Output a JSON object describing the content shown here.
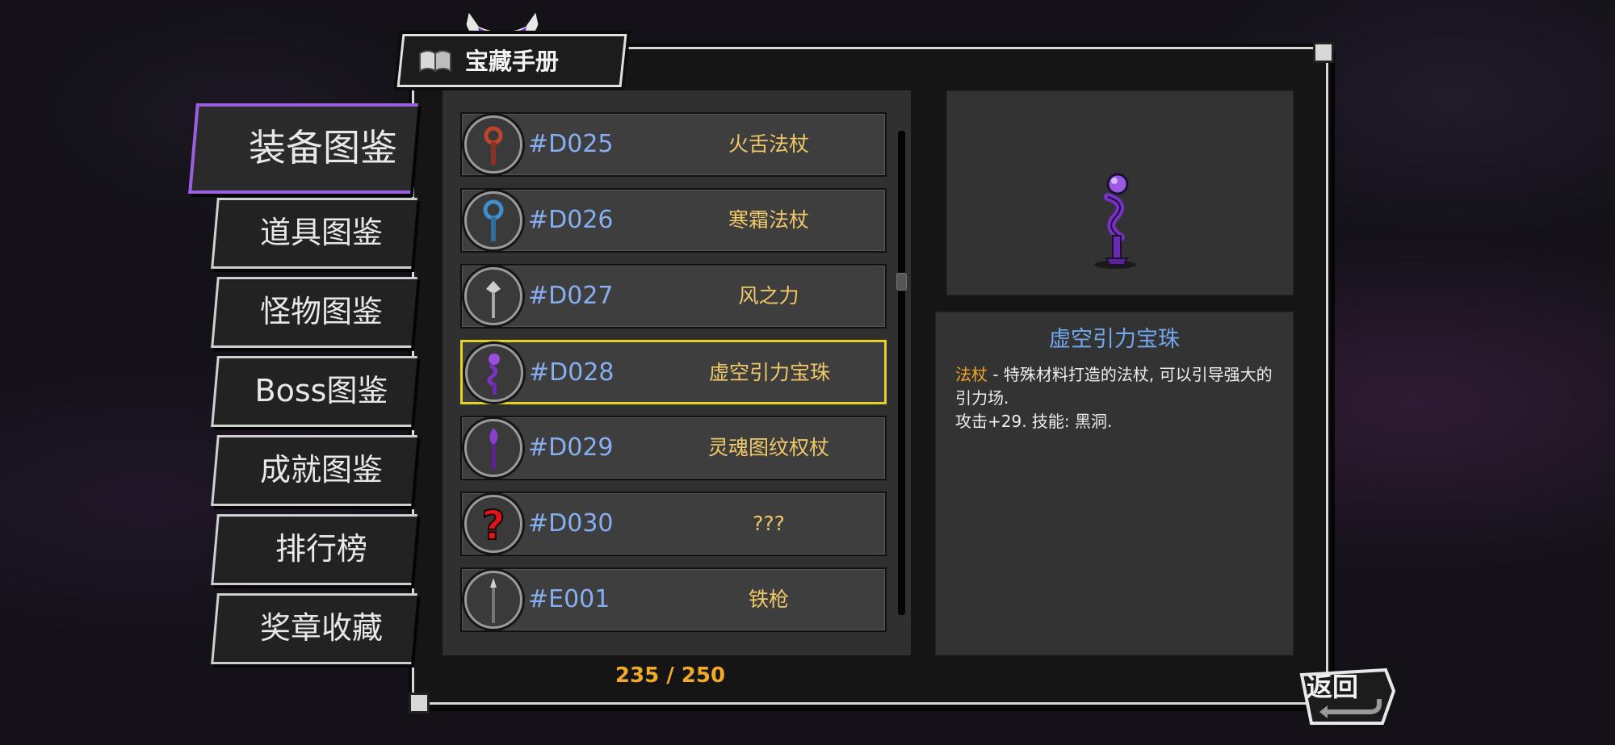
{
  "window": {
    "title": "宝藏手册"
  },
  "categories": [
    {
      "label": "装备图鉴",
      "active": true
    },
    {
      "label": "道具图鉴"
    },
    {
      "label": "怪物图鉴"
    },
    {
      "label": "Boss图鉴"
    },
    {
      "label": "成就图鉴"
    },
    {
      "label": "排行榜"
    },
    {
      "label": "奖章收藏"
    }
  ],
  "list": {
    "items": [
      {
        "code": "#D025",
        "name": "火舌法杖",
        "icon": "fire-staff-icon"
      },
      {
        "code": "#D026",
        "name": "寒霜法杖",
        "icon": "frost-staff-icon"
      },
      {
        "code": "#D027",
        "name": "风之力",
        "icon": "wind-staff-icon"
      },
      {
        "code": "#D028",
        "name": "虚空引力宝珠",
        "icon": "void-orb-staff-icon",
        "selected": true
      },
      {
        "code": "#D029",
        "name": "灵魂图纹权杖",
        "icon": "soul-scepter-icon"
      },
      {
        "code": "#D030",
        "name": "???",
        "icon": "question-mark-icon"
      },
      {
        "code": "#E001",
        "name": "铁枪",
        "icon": "iron-spear-icon"
      }
    ],
    "counter": "235 / 250"
  },
  "detail": {
    "title": "虚空引力宝珠",
    "tag": "法杖",
    "line1": " - 特殊材料打造的法杖, 可以引导强大的引力场.",
    "line2": "攻击+29. 技能: 黑洞."
  },
  "buttons": {
    "back": "返回"
  },
  "colors": {
    "accent_purple": "#9b5fe0",
    "selected_border": "#e3d22a",
    "code_blue": "#86aef0",
    "name_gold": "#f0c868",
    "counter_orange": "#f0a92a",
    "detail_title_blue": "#72a9ee"
  }
}
